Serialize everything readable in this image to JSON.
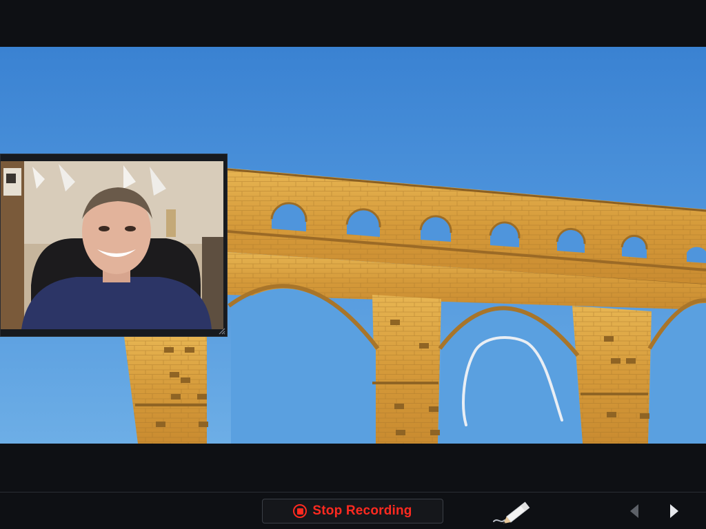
{
  "recording": {
    "stop_label": "Stop Recording",
    "accent_color": "#ff2a20"
  },
  "icons": {
    "stop": "stop-record-icon",
    "pen": "pen-tool-icon",
    "previous": "previous-arrow-icon",
    "next": "next-arrow-icon",
    "resize": "resize-grip-icon"
  },
  "colors": {
    "background": "#0e1014",
    "sky_top": "#3a82d2",
    "sky_bottom": "#6daee6",
    "stone": "#d9a640",
    "ink": "#e9eef4"
  }
}
